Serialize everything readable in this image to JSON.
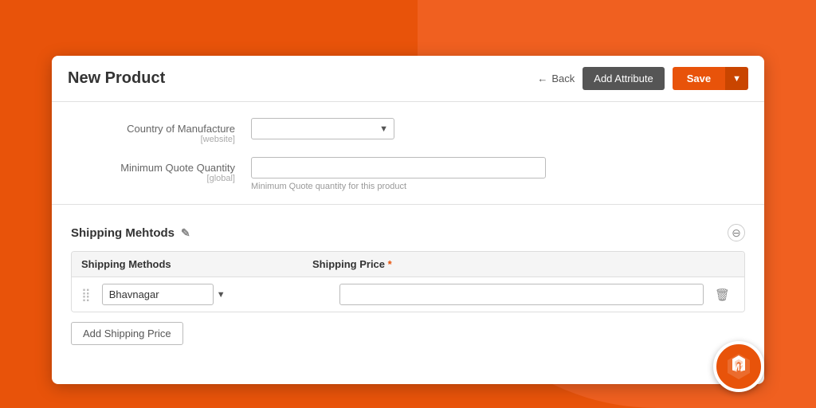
{
  "background": {
    "accent": "#e8530a"
  },
  "header": {
    "title": "New Product",
    "back_label": "Back",
    "add_attribute_label": "Add Attribute",
    "save_label": "Save"
  },
  "form": {
    "country_manufacture": {
      "label": "Country of Manufacture",
      "scope": "[website]",
      "value": ""
    },
    "minimum_quote": {
      "label": "Minimum Quote Quantity",
      "scope": "[global]",
      "hint": "Minimum Quote quantity for this product",
      "value": ""
    }
  },
  "shipping_section": {
    "title": "Shipping Mehtods",
    "table_header_method": "Shipping Methods",
    "table_header_price": "Shipping Price",
    "rows": [
      {
        "method": "Bhavnagar",
        "price": ""
      }
    ],
    "add_button_label": "Add Shipping Price"
  },
  "icons": {
    "back_arrow": "←",
    "dropdown_arrow": "▼",
    "edit_pencil": "✎",
    "collapse": "⊖",
    "drag": "⣿",
    "delete": "🗑",
    "save_caret": "▼"
  },
  "magento_logo": "M2"
}
